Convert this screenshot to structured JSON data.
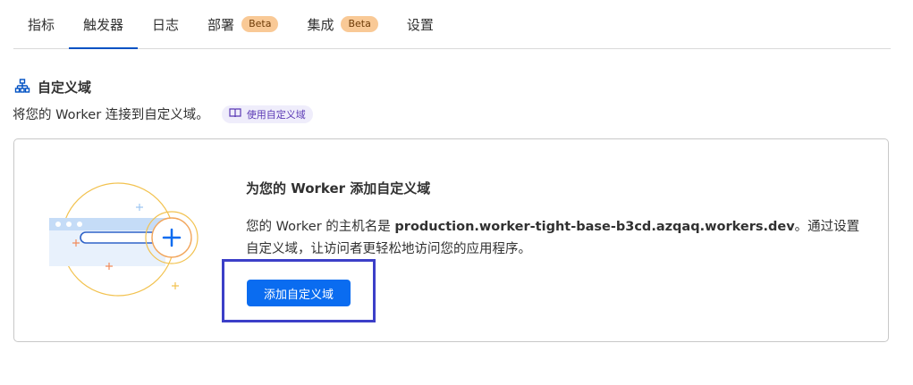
{
  "tabs": [
    {
      "label": "指标"
    },
    {
      "label": "触发器"
    },
    {
      "label": "日志"
    },
    {
      "label": "部署",
      "badge": "Beta"
    },
    {
      "label": "集成",
      "badge": "Beta"
    },
    {
      "label": "设置"
    }
  ],
  "section": {
    "icon": "sitemap-icon",
    "title": "自定义域",
    "description": "将您的 Worker 连接到自定义域。",
    "doc_link": {
      "icon": "book-icon",
      "label": "使用自定义域"
    }
  },
  "card": {
    "illustration": "browser-add-domain-illustration",
    "title": "为您的 Worker 添加自定义域",
    "body_prefix": "您的 Worker 的主机名是 ",
    "hostname": "production.worker-tight-base-b3cd.azqaq.workers.dev",
    "body_suffix": "。通过设置自定义域，让访问者更轻松地访问您的应用程序。",
    "button_label": "添加自定义域"
  },
  "colors": {
    "accent": "#0a6cf0",
    "tab_underline": "#0051c3",
    "badge_bg": "#f9c996",
    "doc_link_bg": "#efedfb",
    "highlight_border": "#3c3fc8"
  }
}
